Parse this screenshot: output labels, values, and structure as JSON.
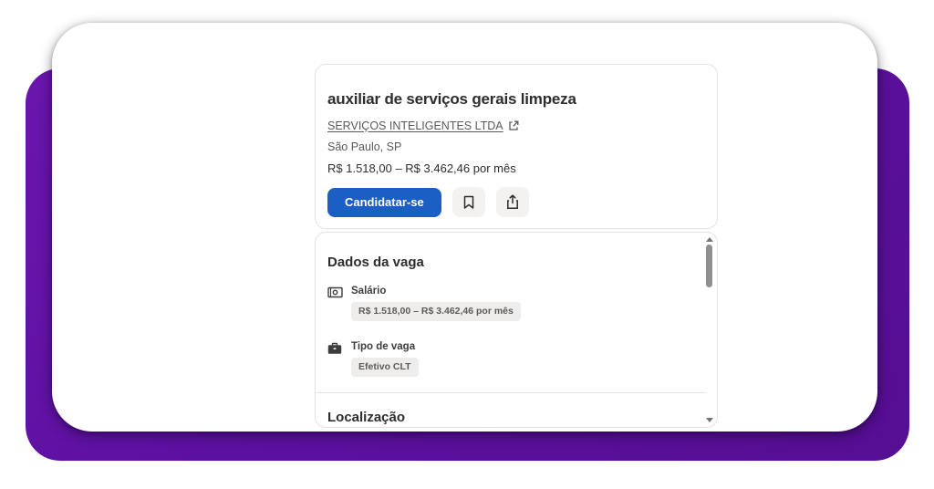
{
  "job_header": {
    "title": "auxiliar de serviços gerais limpeza",
    "company_name": "SERVIÇOS INTELIGENTES LTDA",
    "location": "São Paulo, SP",
    "salary_range": "R$ 1.518,00 – R$ 3.462,46 por mês",
    "apply_button_label": "Candidatar-se",
    "icons": [
      "external-link-icon",
      "bookmark-icon",
      "share-icon"
    ]
  },
  "job_details": {
    "heading": "Dados da vaga",
    "items": [
      {
        "icon": "salary-banknote-icon",
        "label": "Salário",
        "value": "R$ 1.518,00 – R$ 3.462,46 por mês"
      },
      {
        "icon": "briefcase-icon",
        "label": "Tipo de vaga",
        "value": "Efetivo CLT"
      }
    ],
    "next_section_heading": "Localização"
  },
  "colors": {
    "backdrop_purple": "#5c10a0",
    "apply_button_blue": "#1b5ec4",
    "card_border": "#e4e2e0",
    "icon_button_bg": "#f3f2f1",
    "pill_bg": "#eeedeb",
    "text_primary": "#2d2d2d",
    "text_secondary": "#595959"
  }
}
